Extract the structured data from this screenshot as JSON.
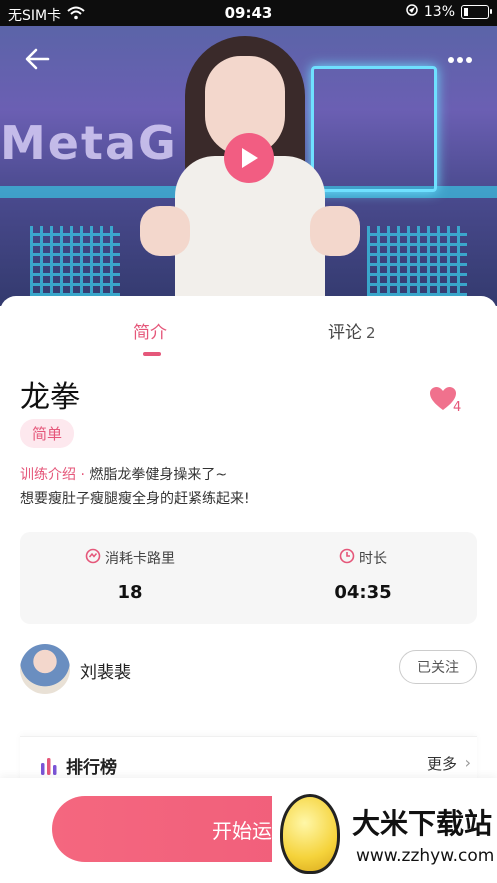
{
  "status_bar": {
    "carrier": "无SIM卡",
    "time": "09:43",
    "battery": "13%"
  },
  "hero": {
    "background_text": "MetaG",
    "accent": "#f25d82"
  },
  "tabs": {
    "intro": "简介",
    "comments": "评论",
    "comment_count": "2"
  },
  "workout": {
    "title": "龙拳",
    "like_count": "4",
    "difficulty": "简单",
    "description_label": "训练介绍 ·",
    "description": " 燃脂龙拳健身操来了~\n想要瘦肚子瘦腿瘦全身的赶紧练起来!"
  },
  "stats": {
    "calories_label": "消耗卡路里",
    "calories_value": "18",
    "duration_label": "时长",
    "duration_value": "04:35"
  },
  "author": {
    "name": "刘裴裴",
    "follow_label": "已关注"
  },
  "ranking": {
    "title": "排行榜",
    "more": "更多"
  },
  "bottom": {
    "start_label": "开始运动"
  },
  "watermark": {
    "title": "大米下载站",
    "url": "www.zzhyw.com"
  },
  "colors": {
    "accent": "#e5577a",
    "tag_bg": "#fde8ee"
  }
}
